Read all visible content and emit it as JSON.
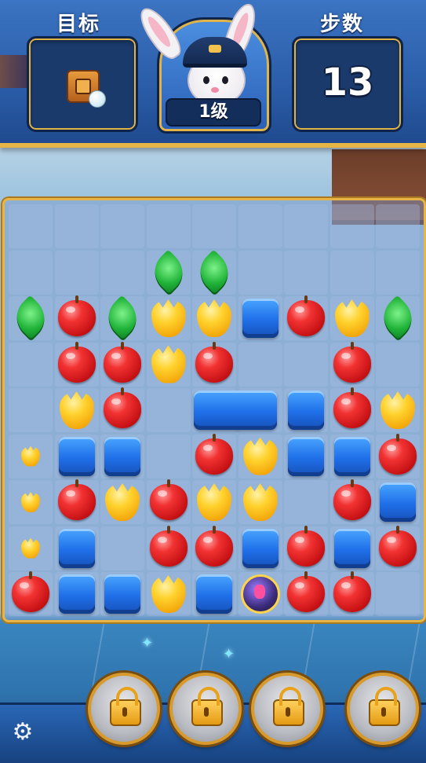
{
  "header": {
    "goal_label": "目标",
    "moves_label": "步数",
    "moves_value": "13",
    "level_label": "1级"
  },
  "goal": {
    "icon": "crate-icon"
  },
  "avatar": {
    "icon": "pilot-bunny-avatar"
  },
  "boosters": [
    {
      "name": "booster-1",
      "state": "locked"
    },
    {
      "name": "booster-2",
      "state": "locked"
    },
    {
      "name": "booster-3",
      "state": "locked"
    },
    {
      "name": "booster-4",
      "state": "locked"
    }
  ],
  "board": {
    "rows": 9,
    "cols": 9,
    "tiles": [
      [
        "",
        "",
        "",
        "",
        "",
        "",
        "",
        "",
        ""
      ],
      [
        "",
        "",
        "",
        "leaf",
        "leaf",
        "",
        "",
        "",
        ""
      ],
      [
        "leaf",
        "apple",
        "leaf",
        "tulip",
        "tulip",
        "block",
        "apple",
        "tulip",
        "leaf"
      ],
      [
        "",
        "apple",
        "apple",
        "tulip",
        "apple",
        "",
        "",
        "apple",
        ""
      ],
      [
        "",
        "tulip",
        "apple",
        "",
        "block-wide",
        "",
        "block",
        "apple",
        "tulip"
      ],
      [
        "tulip-small",
        "block",
        "block",
        "",
        "apple",
        "tulip",
        "block",
        "block",
        "apple"
      ],
      [
        "tulip-small",
        "apple",
        "tulip",
        "apple",
        "tulip",
        "tulip",
        "",
        "apple",
        "block"
      ],
      [
        "tulip-small",
        "block",
        "",
        "apple",
        "apple",
        "block",
        "apple",
        "block",
        "apple"
      ],
      [
        "apple",
        "block",
        "block",
        "tulip",
        "block",
        "bomb",
        "apple",
        "apple",
        ""
      ]
    ]
  }
}
